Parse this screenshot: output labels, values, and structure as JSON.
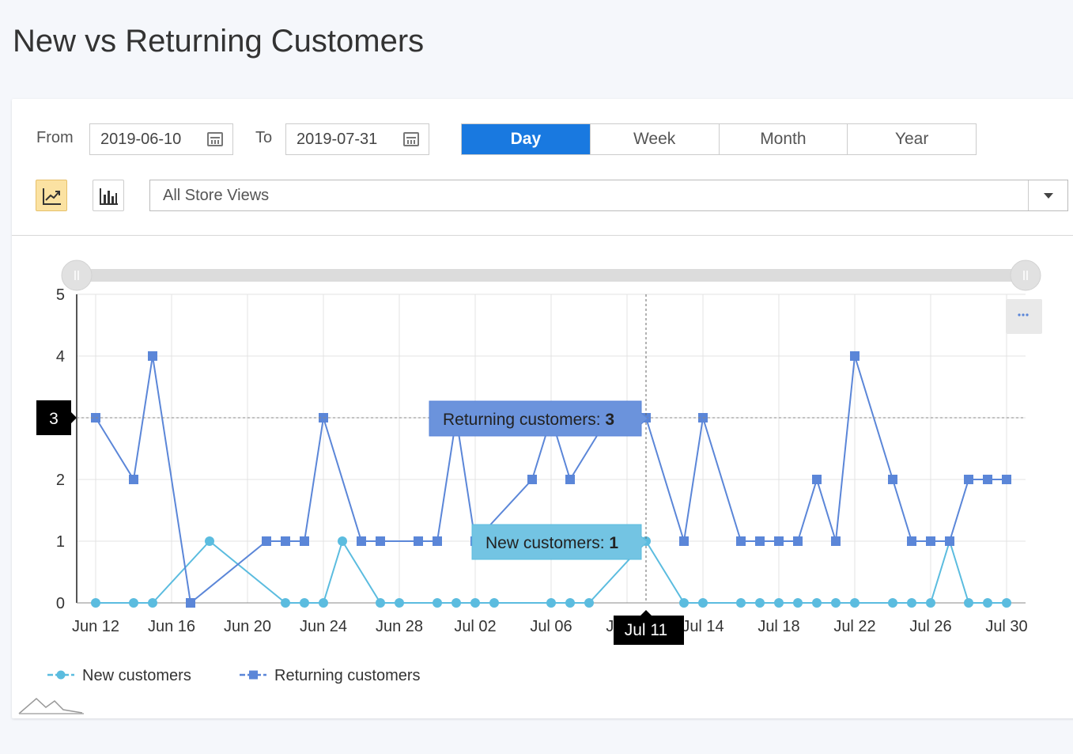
{
  "page": {
    "title": "New vs Returning Customers"
  },
  "filters": {
    "from_label": "From",
    "from_value": "2019-06-10",
    "to_label": "To",
    "to_value": "2019-07-31",
    "periods": [
      "Day",
      "Week",
      "Month",
      "Year"
    ],
    "active_period": "Day",
    "store_view": "All Store Views",
    "chart_modes": [
      "line-chart-icon",
      "bar-chart-icon"
    ],
    "active_chart_mode": "line-chart-icon"
  },
  "hover": {
    "date_label": "Jul 11",
    "y_label": "3",
    "tooltips": [
      {
        "series": "Returning customers",
        "text": "Returning customers:",
        "value": "3"
      },
      {
        "series": "New customers",
        "text": "New customers:",
        "value": "1"
      }
    ]
  },
  "chart_data": {
    "type": "line",
    "x_start": "2019-06-12",
    "xlim": [
      "2019-06-11",
      "2019-07-31"
    ],
    "ylim": [
      0,
      5
    ],
    "y_ticks": [
      0,
      1,
      2,
      3,
      4,
      5
    ],
    "x_tick_labels": [
      "Jun 12",
      "Jun 16",
      "Jun 20",
      "Jun 24",
      "Jun 28",
      "Jul 02",
      "Jul 06",
      "Jul 10",
      "Jul 14",
      "Jul 18",
      "Jul 22",
      "Jul 26",
      "Jul 30"
    ],
    "grid": true,
    "legend": "bottom-left",
    "series": [
      {
        "name": "New customers",
        "color": "#5bbcdf",
        "marker": "circle",
        "points": [
          [
            "2019-06-12",
            0
          ],
          [
            "2019-06-14",
            0
          ],
          [
            "2019-06-15",
            0
          ],
          [
            "2019-06-18",
            1
          ],
          [
            "2019-06-22",
            0
          ],
          [
            "2019-06-23",
            0
          ],
          [
            "2019-06-24",
            0
          ],
          [
            "2019-06-25",
            1
          ],
          [
            "2019-06-27",
            0
          ],
          [
            "2019-06-28",
            0
          ],
          [
            "2019-06-30",
            0
          ],
          [
            "2019-07-01",
            0
          ],
          [
            "2019-07-02",
            0
          ],
          [
            "2019-07-03",
            0
          ],
          [
            "2019-07-06",
            0
          ],
          [
            "2019-07-07",
            0
          ],
          [
            "2019-07-08",
            0
          ],
          [
            "2019-07-11",
            1
          ],
          [
            "2019-07-13",
            0
          ],
          [
            "2019-07-14",
            0
          ],
          [
            "2019-07-16",
            0
          ],
          [
            "2019-07-17",
            0
          ],
          [
            "2019-07-18",
            0
          ],
          [
            "2019-07-19",
            0
          ],
          [
            "2019-07-20",
            0
          ],
          [
            "2019-07-21",
            0
          ],
          [
            "2019-07-22",
            0
          ],
          [
            "2019-07-24",
            0
          ],
          [
            "2019-07-25",
            0
          ],
          [
            "2019-07-26",
            0
          ],
          [
            "2019-07-27",
            1
          ],
          [
            "2019-07-28",
            0
          ],
          [
            "2019-07-29",
            0
          ],
          [
            "2019-07-30",
            0
          ]
        ]
      },
      {
        "name": "Returning customers",
        "color": "#5b86d8",
        "marker": "square",
        "points": [
          [
            "2019-06-12",
            3
          ],
          [
            "2019-06-14",
            2
          ],
          [
            "2019-06-15",
            4
          ],
          [
            "2019-06-17",
            0
          ],
          [
            "2019-06-21",
            1
          ],
          [
            "2019-06-22",
            1
          ],
          [
            "2019-06-23",
            1
          ],
          [
            "2019-06-24",
            3
          ],
          [
            "2019-06-26",
            1
          ],
          [
            "2019-06-27",
            1
          ],
          [
            "2019-06-29",
            1
          ],
          [
            "2019-06-30",
            1
          ],
          [
            "2019-07-01",
            3
          ],
          [
            "2019-07-02",
            1
          ],
          [
            "2019-07-05",
            2
          ],
          [
            "2019-07-06",
            3
          ],
          [
            "2019-07-07",
            2
          ],
          [
            "2019-07-09",
            3
          ],
          [
            "2019-07-11",
            3
          ],
          [
            "2019-07-13",
            1
          ],
          [
            "2019-07-14",
            3
          ],
          [
            "2019-07-16",
            1
          ],
          [
            "2019-07-17",
            1
          ],
          [
            "2019-07-18",
            1
          ],
          [
            "2019-07-19",
            1
          ],
          [
            "2019-07-20",
            2
          ],
          [
            "2019-07-21",
            1
          ],
          [
            "2019-07-22",
            4
          ],
          [
            "2019-07-24",
            2
          ],
          [
            "2019-07-25",
            1
          ],
          [
            "2019-07-26",
            1
          ],
          [
            "2019-07-27",
            1
          ],
          [
            "2019-07-28",
            2
          ],
          [
            "2019-07-29",
            2
          ],
          [
            "2019-07-30",
            2
          ]
        ]
      }
    ]
  }
}
